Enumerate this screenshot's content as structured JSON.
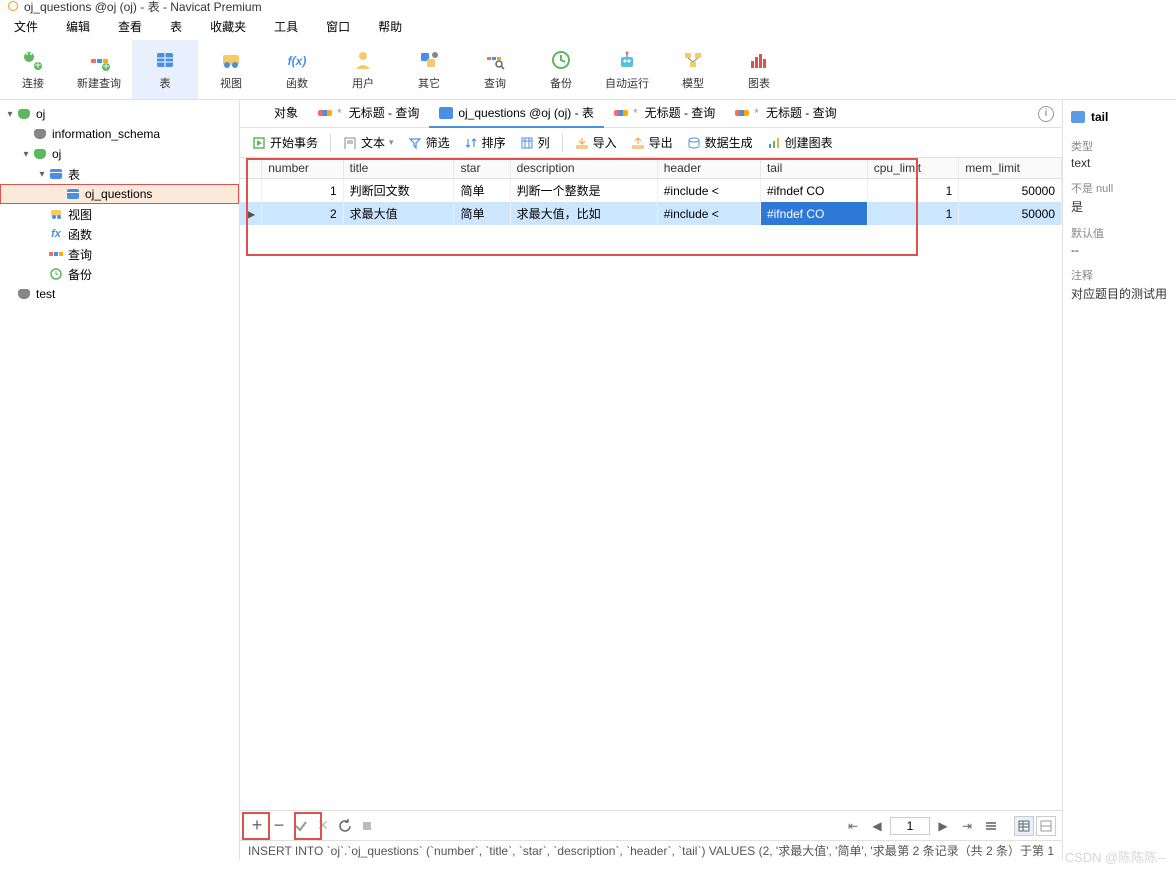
{
  "title": "oj_questions @oj (oj) - 表 - Navicat Premium",
  "menu": [
    "文件",
    "编辑",
    "查看",
    "表",
    "收藏夹",
    "工具",
    "窗口",
    "帮助"
  ],
  "toolbar": [
    {
      "label": "连接",
      "icon": "plug"
    },
    {
      "label": "新建查询",
      "icon": "query"
    },
    {
      "label": "表",
      "icon": "table",
      "active": true
    },
    {
      "label": "视图",
      "icon": "view"
    },
    {
      "label": "函数",
      "icon": "fx"
    },
    {
      "label": "用户",
      "icon": "user"
    },
    {
      "label": "其它",
      "icon": "other"
    },
    {
      "label": "查询",
      "icon": "search"
    },
    {
      "label": "备份",
      "icon": "backup"
    },
    {
      "label": "自动运行",
      "icon": "robot"
    },
    {
      "label": "模型",
      "icon": "model"
    },
    {
      "label": "图表",
      "icon": "chart"
    }
  ],
  "tree": [
    {
      "level": 0,
      "label": "oj",
      "icon": "db-green",
      "chev": "▾"
    },
    {
      "level": 1,
      "label": "information_schema",
      "icon": "db",
      "chev": ""
    },
    {
      "level": 1,
      "label": "oj",
      "icon": "db-green",
      "chev": "▾"
    },
    {
      "level": 2,
      "label": "表",
      "icon": "table",
      "chev": "▾"
    },
    {
      "level": 3,
      "label": "oj_questions",
      "icon": "table",
      "chev": "",
      "selected": true
    },
    {
      "level": 2,
      "label": "视图",
      "icon": "view",
      "chev": ""
    },
    {
      "level": 2,
      "label": "函数",
      "icon": "fx",
      "chev": ""
    },
    {
      "level": 2,
      "label": "查询",
      "icon": "query",
      "chev": ""
    },
    {
      "level": 2,
      "label": "备份",
      "icon": "backup",
      "chev": ""
    },
    {
      "level": 0,
      "label": "test",
      "icon": "db",
      "chev": ""
    }
  ],
  "tabs": [
    {
      "label": "对象",
      "icon": "none"
    },
    {
      "label": "无标题 - 查询",
      "icon": "query",
      "dirty": true
    },
    {
      "label": "oj_questions @oj (oj) - 表",
      "icon": "table",
      "active": true
    },
    {
      "label": "无标题 - 查询",
      "icon": "query",
      "dirty": true
    },
    {
      "label": "无标题 - 查询",
      "icon": "query",
      "dirty": true
    }
  ],
  "actions": {
    "begin": "开始事务",
    "text": "文本",
    "filter": "筛选",
    "sort": "排序",
    "column": "列",
    "import": "导入",
    "export": "导出",
    "datagen": "数据生成",
    "chart": "创建图表"
  },
  "columns": [
    "number",
    "title",
    "star",
    "description",
    "header",
    "tail",
    "cpu_limit",
    "mem_limit"
  ],
  "rows": [
    {
      "number": "1",
      "title": "判断回文数",
      "star": "简单",
      "description": "判断一个整数是",
      "header": "#include <",
      "tail": "#ifndef CO",
      "cpu_limit": "1",
      "mem_limit": "50000"
    },
    {
      "number": "2",
      "title": "求最大值",
      "star": "简单",
      "description": "求最大值，比如",
      "header": "#include <",
      "tail": "#ifndef CO",
      "cpu_limit": "1",
      "mem_limit": "50000",
      "selected": true,
      "sel_col": "tail"
    }
  ],
  "panel": {
    "title": "tail",
    "type_label": "类型",
    "type_value": "text",
    "null_label": "不是 null",
    "null_value": "是",
    "default_label": "默认值",
    "default_value": "--",
    "comment_label": "注释",
    "comment_value": "对应题目的测试用"
  },
  "nav": {
    "page": "1"
  },
  "status": {
    "sql": "INSERT INTO `oj`.`oj_questions` (`number`, `title`, `star`, `description`, `header`, `tail`) VALUES (2, '求最大值', '简单', '求最",
    "right": "第 2 条记录（共 2 条）于第 1"
  },
  "watermark": "CSDN @陈陈陈--"
}
